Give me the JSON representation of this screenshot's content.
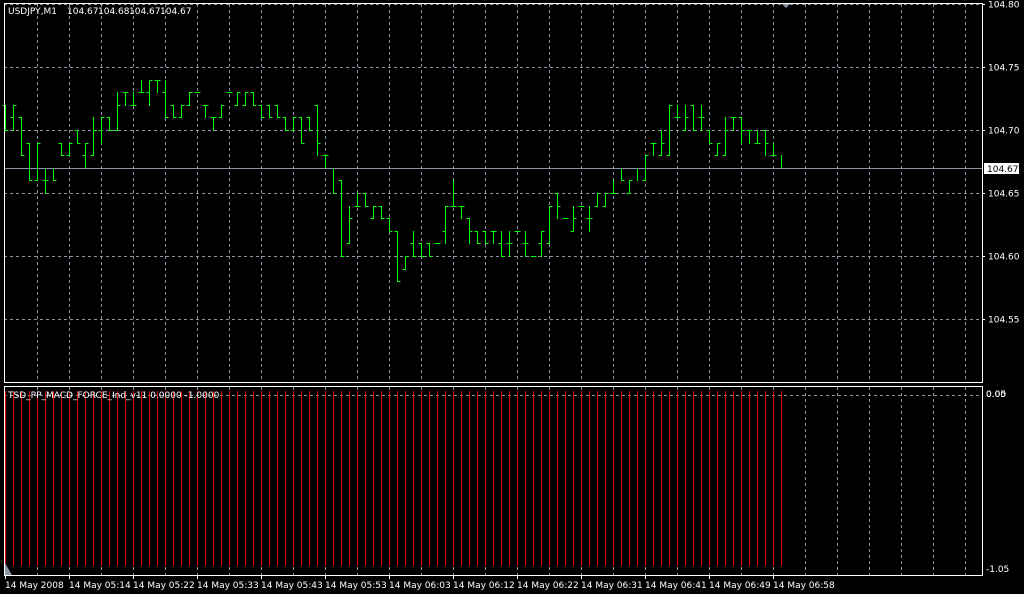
{
  "window": {
    "symbol_title": "USDJPY,M1",
    "ohlc": [
      "104.67",
      "104.68",
      "104.67",
      "104.67"
    ]
  },
  "indicator": {
    "title": "TSD_PP_MACD_FORCE_Ind_v11 0.0000 -1.0000",
    "axis_labels": [
      "0.05",
      "0.00",
      "-1.05"
    ],
    "bar_color": "#e00000",
    "bar_value": -1.0
  },
  "colors": {
    "background": "#000000",
    "bar": "#00ff00",
    "grid": "#8c96a5",
    "frame": "#ffffff",
    "bid_line": "#8c96a5"
  },
  "price_axis": {
    "labels": [
      "104.80",
      "104.75",
      "104.70",
      "104.65",
      "104.60",
      "104.55"
    ],
    "bid_label": "104.67"
  },
  "time_axis": {
    "labels": [
      "14 May 2008",
      "14 May 05:14",
      "14 May 05:22",
      "14 May 05:33",
      "14 May 05:43",
      "14 May 05:53",
      "14 May 06:03",
      "14 May 06:12",
      "14 May 06:22",
      "14 May 06:31",
      "14 May 06:41",
      "14 May 06:49",
      "14 May 06:58"
    ]
  },
  "chart_data": {
    "type": "ohlc",
    "title": "USDJPY,M1",
    "ylim": [
      104.5,
      104.8
    ],
    "bid": 104.67,
    "bars": [
      [
        104.72,
        104.72,
        104.7,
        104.7
      ],
      [
        104.71,
        104.72,
        104.7,
        104.72
      ],
      [
        104.71,
        104.71,
        104.68,
        104.68
      ],
      [
        104.69,
        104.69,
        104.66,
        104.66
      ],
      [
        104.66,
        104.69,
        104.66,
        104.69
      ],
      [
        104.66,
        104.67,
        104.65,
        104.66
      ],
      [
        104.67,
        104.67,
        104.66,
        104.66
      ],
      [
        104.69,
        104.69,
        104.68,
        104.68
      ],
      [
        104.68,
        104.69,
        104.68,
        104.69
      ],
      [
        104.7,
        104.7,
        104.69,
        104.69
      ],
      [
        104.68,
        104.69,
        104.67,
        104.69
      ],
      [
        104.68,
        104.71,
        104.68,
        104.7
      ],
      [
        104.7,
        104.71,
        104.69,
        104.71
      ],
      [
        104.71,
        104.71,
        104.7,
        104.7
      ],
      [
        104.7,
        104.73,
        104.7,
        104.72
      ],
      [
        104.73,
        104.73,
        104.72,
        104.73
      ],
      [
        104.72,
        104.73,
        104.72,
        104.72
      ],
      [
        104.73,
        104.74,
        104.73,
        104.73
      ],
      [
        104.73,
        104.74,
        104.72,
        104.74
      ],
      [
        104.74,
        104.74,
        104.73,
        104.74
      ],
      [
        104.73,
        104.74,
        104.71,
        104.71
      ],
      [
        104.72,
        104.72,
        104.71,
        104.71
      ],
      [
        104.71,
        104.72,
        104.71,
        104.72
      ],
      [
        104.72,
        104.73,
        104.72,
        104.73
      ],
      [
        104.73,
        104.73,
        104.73,
        104.73
      ],
      [
        104.72,
        104.72,
        104.71,
        104.72
      ],
      [
        104.71,
        104.71,
        104.7,
        104.71
      ],
      [
        104.71,
        104.72,
        104.71,
        104.72
      ],
      [
        104.73,
        104.73,
        104.73,
        104.73
      ],
      [
        104.72,
        104.73,
        104.72,
        104.73
      ],
      [
        104.72,
        104.73,
        104.72,
        104.73
      ],
      [
        104.73,
        104.73,
        104.72,
        104.72
      ],
      [
        104.72,
        104.72,
        104.71,
        104.71
      ],
      [
        104.72,
        104.72,
        104.71,
        104.71
      ],
      [
        104.72,
        104.72,
        104.71,
        104.71
      ],
      [
        104.71,
        104.71,
        104.7,
        104.7
      ],
      [
        104.7,
        104.71,
        104.7,
        104.71
      ],
      [
        104.71,
        104.71,
        104.69,
        104.69
      ],
      [
        104.71,
        104.71,
        104.7,
        104.7
      ],
      [
        104.72,
        104.72,
        104.68,
        104.69
      ],
      [
        104.68,
        104.68,
        104.67,
        104.68
      ],
      [
        104.67,
        104.67,
        104.65,
        104.65
      ],
      [
        104.66,
        104.66,
        104.6,
        104.6
      ],
      [
        104.61,
        104.64,
        104.61,
        104.63
      ],
      [
        104.64,
        104.65,
        104.64,
        104.64
      ],
      [
        104.65,
        104.65,
        104.64,
        104.64
      ],
      [
        104.63,
        104.64,
        104.63,
        104.64
      ],
      [
        104.64,
        104.64,
        104.63,
        104.63
      ],
      [
        104.63,
        104.63,
        104.62,
        104.62
      ],
      [
        104.62,
        104.62,
        104.58,
        104.58
      ],
      [
        104.59,
        104.6,
        104.59,
        104.6
      ],
      [
        104.61,
        104.62,
        104.6,
        104.6
      ],
      [
        104.61,
        104.61,
        104.6,
        104.6
      ],
      [
        104.61,
        104.61,
        104.6,
        104.6
      ],
      [
        104.61,
        104.61,
        104.61,
        104.61
      ],
      [
        104.62,
        104.64,
        104.61,
        104.64
      ],
      [
        104.64,
        104.66,
        104.64,
        104.64
      ],
      [
        104.64,
        104.64,
        104.63,
        104.64
      ],
      [
        104.63,
        104.63,
        104.61,
        104.62
      ],
      [
        104.62,
        104.62,
        104.61,
        104.61
      ],
      [
        104.62,
        104.62,
        104.61,
        104.61
      ],
      [
        104.62,
        104.62,
        104.61,
        104.62
      ],
      [
        104.61,
        104.62,
        104.6,
        104.6
      ],
      [
        104.61,
        104.62,
        104.6,
        104.61
      ],
      [
        104.62,
        104.62,
        104.62,
        104.62
      ],
      [
        104.61,
        104.62,
        104.6,
        104.61
      ],
      [
        104.6,
        104.6,
        104.6,
        104.6
      ],
      [
        104.61,
        104.62,
        104.6,
        104.62
      ],
      [
        104.61,
        104.64,
        104.61,
        104.64
      ],
      [
        104.65,
        104.65,
        104.63,
        104.64
      ],
      [
        104.63,
        104.63,
        104.63,
        104.63
      ],
      [
        104.62,
        104.64,
        104.62,
        104.63
      ],
      [
        104.64,
        104.64,
        104.64,
        104.64
      ],
      [
        104.63,
        104.64,
        104.62,
        104.63
      ],
      [
        104.64,
        104.65,
        104.64,
        104.65
      ],
      [
        104.64,
        104.65,
        104.64,
        104.65
      ],
      [
        104.65,
        104.66,
        104.65,
        104.65
      ],
      [
        104.67,
        104.67,
        104.66,
        104.66
      ],
      [
        104.65,
        104.66,
        104.65,
        104.66
      ],
      [
        104.67,
        104.67,
        104.66,
        104.67
      ],
      [
        104.66,
        104.68,
        104.66,
        104.68
      ],
      [
        104.69,
        104.69,
        104.68,
        104.69
      ],
      [
        104.68,
        104.7,
        104.68,
        104.69
      ],
      [
        104.68,
        104.72,
        104.68,
        104.72
      ],
      [
        104.71,
        104.72,
        104.71,
        104.71
      ],
      [
        104.7,
        104.72,
        104.7,
        104.71
      ],
      [
        104.72,
        104.72,
        104.7,
        104.7
      ],
      [
        104.71,
        104.72,
        104.7,
        104.71
      ],
      [
        104.7,
        104.7,
        104.69,
        104.69
      ],
      [
        104.68,
        104.69,
        104.68,
        104.69
      ],
      [
        104.68,
        104.71,
        104.68,
        104.7
      ],
      [
        104.71,
        104.71,
        104.7,
        104.71
      ],
      [
        104.71,
        104.71,
        104.69,
        104.7
      ],
      [
        104.7,
        104.7,
        104.69,
        104.7
      ],
      [
        104.69,
        104.7,
        104.69,
        104.69
      ],
      [
        104.7,
        104.7,
        104.68,
        104.69
      ],
      [
        104.68,
        104.69,
        104.68,
        104.68
      ],
      [
        104.67,
        104.68,
        104.67,
        104.67
      ]
    ]
  }
}
